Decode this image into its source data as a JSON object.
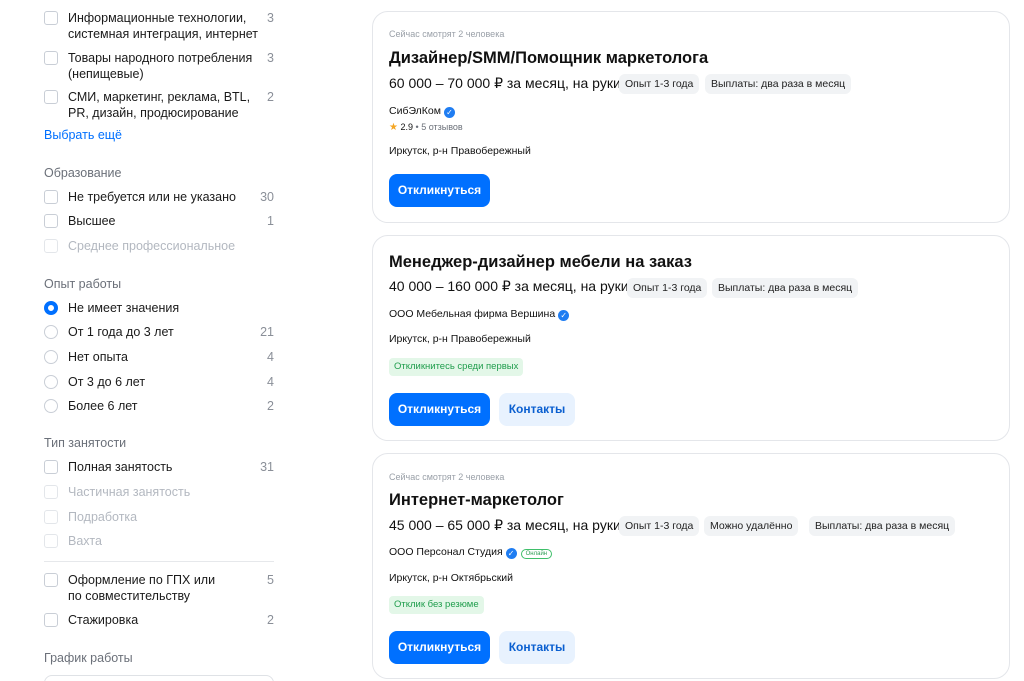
{
  "filters": {
    "industry": {
      "items": [
        {
          "label": "Информационные технологии, системная интеграция, интернет",
          "count": "3"
        },
        {
          "label": "Товары народного потребления (непищевые)",
          "count": "3"
        },
        {
          "label": "СМИ, маркетинг, реклама, BTL, PR, дизайн, продюсирование",
          "count": "2"
        }
      ],
      "more_label": "Выбрать ещё"
    },
    "education": {
      "title": "Образование",
      "items": [
        {
          "label": "Не требуется или не указано",
          "count": "30"
        },
        {
          "label": "Высшее",
          "count": "1"
        },
        {
          "label": "Среднее профессиональное",
          "count": ""
        }
      ]
    },
    "experience": {
      "title": "Опыт работы",
      "items": [
        {
          "label": "Не имеет значения",
          "count": "",
          "selected": true
        },
        {
          "label": "От 1 года до 3 лет",
          "count": "21"
        },
        {
          "label": "Нет опыта",
          "count": "4"
        },
        {
          "label": "От 3 до 6 лет",
          "count": "4"
        },
        {
          "label": "Более 6 лет",
          "count": "2"
        }
      ]
    },
    "employment": {
      "title": "Тип занятости",
      "items": [
        {
          "label": "Полная занятость",
          "count": "31"
        },
        {
          "label": "Частичная занятость",
          "count": ""
        },
        {
          "label": "Подработка",
          "count": ""
        },
        {
          "label": "Вахта",
          "count": ""
        }
      ],
      "extra": [
        {
          "label": "Оформление по ГПХ или по совместительству",
          "count": "5"
        },
        {
          "label": "Стажировка",
          "count": "2"
        }
      ]
    },
    "schedule": {
      "title": "График работы"
    }
  },
  "vacancies": [
    {
      "viewers": "Сейчас смотрят 2 человека",
      "title": "Дизайнер/SMM/Помощник маркетолога",
      "salary": "60 000 – 70 000 ₽ за месяц, на руки",
      "tags": [
        "Опыт 1-3 года",
        "Выплаты: два раза в месяц"
      ],
      "company": "СибЭлКом",
      "rating": "2.9",
      "reviews": "5 отзывов",
      "location": "Иркутск, р-н Правобережный",
      "apply_label": "Откликнуться"
    },
    {
      "title": "Менеджер-дизайнер мебели на заказ",
      "salary": "40 000 – 160 000 ₽ за месяц, на руки",
      "tags": [
        "Опыт 1-3 года",
        "Выплаты: два раза в месяц"
      ],
      "company": "ООО Мебельная фирма Вершина",
      "location": "Иркутск, р-н Правобережный",
      "hint": "Откликнитесь среди первых",
      "apply_label": "Откликнуться",
      "contacts_label": "Контакты"
    },
    {
      "viewers": "Сейчас смотрят 2 человека",
      "title": "Интернет-маркетолог",
      "salary": "45 000 – 65 000 ₽ за месяц, на руки",
      "tags": [
        "Опыт 1-3 года",
        "Можно удалённо",
        "Выплаты: два раза в месяц"
      ],
      "company": "ООО Персонал Студия",
      "online_badge": "Онлайн",
      "location": "Иркутск, р-н Октябрьский",
      "hint": "Отклик без резюме",
      "apply_label": "Откликнуться",
      "contacts_label": "Контакты"
    }
  ],
  "colors": {
    "accent": "#0070ff",
    "hint_bg": "#e3f7e8",
    "hint_text": "#1f9d4c"
  }
}
